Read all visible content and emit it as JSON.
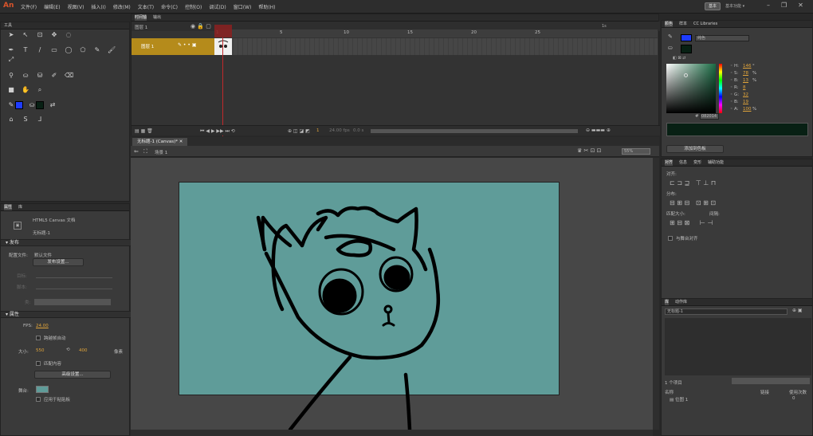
{
  "app": {
    "logo": "An"
  },
  "menu": [
    "文件(F)",
    "编辑(E)",
    "视图(V)",
    "插入(I)",
    "修改(M)",
    "文本(T)",
    "命令(C)",
    "控制(O)",
    "调试(D)",
    "窗口(W)",
    "帮助(H)"
  ],
  "workspace_button": "基本",
  "search_placeholder": "基本功能 ▾",
  "window_controls": [
    "–",
    "❐",
    "✕"
  ],
  "tools_panel": {
    "title": "工具"
  },
  "timeline": {
    "tabs": [
      "时间轴",
      "输出"
    ],
    "layer_header_label": "图层 1",
    "ruler_marks": [
      "1",
      "5",
      "10",
      "15",
      "20",
      "25"
    ],
    "second_marker": "1s",
    "layer_name": "图层 1",
    "current_frame": "1",
    "fps_display": "24.00 fps",
    "time_display": "0.0 s"
  },
  "document": {
    "tab_label": "无标题-1 (Canvas)*",
    "breadcrumb": "场景 1",
    "zoom": "55%"
  },
  "properties": {
    "tabs": [
      "属性",
      "库",
      "动作代码"
    ],
    "doc_type": "HTML5 Canvas 文档",
    "doc_name": "无标题-1",
    "publish_section": "发布",
    "profile_label": "配置文件:",
    "profile_value": "默认文件",
    "publish_settings_btn": "发布设置...",
    "target_label": "目标:",
    "script_label": "脚本:",
    "class_label": "类:",
    "attributes_section": "属性",
    "fps_label": "FPS:",
    "fps_value": "24.00",
    "scale_span_label": "跨越帧自动",
    "size_label": "大小:",
    "width_value": "550",
    "height_value": "400",
    "width_unit": "像素",
    "match_content": "匹配内容",
    "advanced_btn": "高级设置...",
    "stage_label": "舞台:",
    "apply_paste": "应用于粘贴板"
  },
  "color_panel": {
    "tabs": [
      "颜色",
      "样本",
      "CC Libraries"
    ],
    "fill_type": "纯色",
    "H": "146",
    "S": "78",
    "B": "13",
    "R": "8",
    "G": "32",
    "Bv": "19",
    "A": "100",
    "hex": "082014",
    "h_unit": "°",
    "pct": "%",
    "hash": "#",
    "add_swatch": "添加到色板",
    "swatch_color": "#082014",
    "accent_blue": "#1e3cff"
  },
  "align_panel": {
    "tabs": [
      "对齐",
      "信息",
      "变形",
      "辅助功能"
    ],
    "align_label": "对齐:",
    "distribute_label": "分布:",
    "match_size_label": "匹配大小:",
    "spacing_label": "间隔:",
    "to_stage": "与舞台对齐"
  },
  "library_panel": {
    "tabs": [
      "库",
      "动作库"
    ],
    "doc_select": "无标题-1",
    "item_count": "1 个项目",
    "col_name": "名称",
    "col_linkage": "链接",
    "col_use": "使用次数",
    "item_name": "位图 1",
    "item_use": "0"
  },
  "canvas": {
    "stage_color": "#5f9c99",
    "pasteboard_color": "#474747"
  }
}
